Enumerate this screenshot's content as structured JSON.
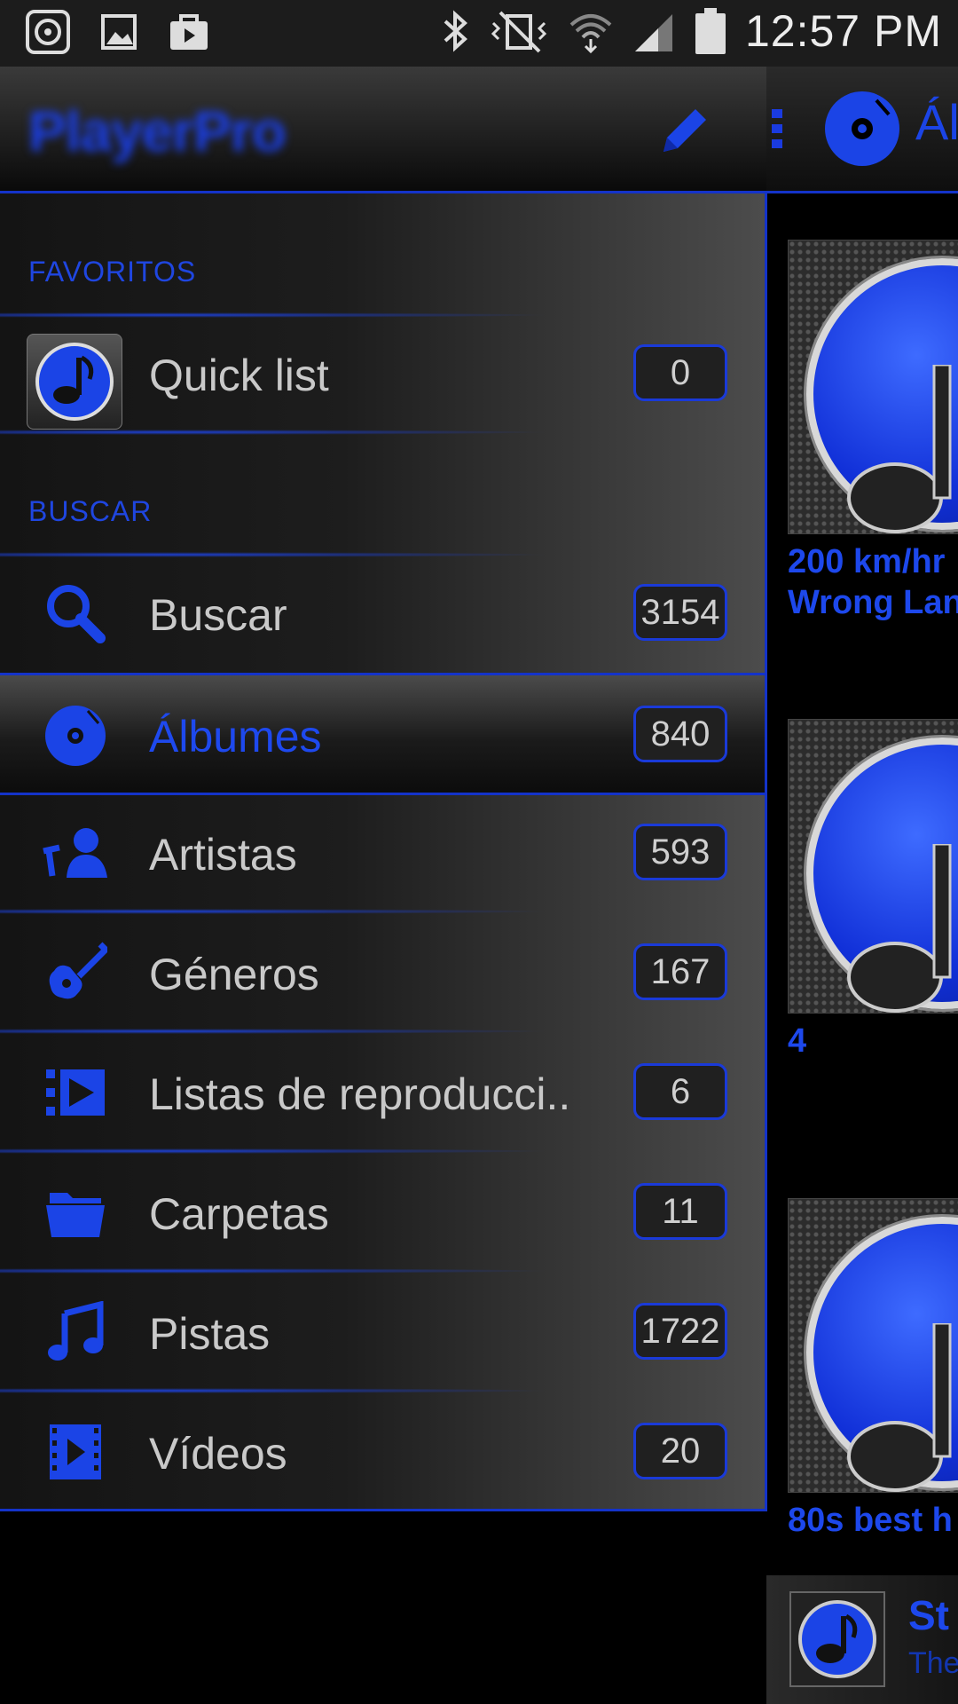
{
  "status_bar": {
    "time": "12:57 PM",
    "left_icons": [
      "media-icon",
      "gallery-icon",
      "store-bag-icon"
    ],
    "right_icons": [
      "bluetooth-icon",
      "vibrate-mute-icon",
      "wifi-icon",
      "signal-icon",
      "battery-icon"
    ]
  },
  "drawer": {
    "app_title": "PlayerPro",
    "edit_icon": "pencil-icon",
    "sections": {
      "favorites": "FAVORITOS",
      "search": "BUSCAR"
    },
    "items": [
      {
        "label": "Quick list",
        "count": "0",
        "icon": "music-note-app-icon"
      },
      {
        "label": "Buscar",
        "count": "3154",
        "icon": "search-icon"
      },
      {
        "label": "Álbumes",
        "count": "840",
        "icon": "album-disc-icon",
        "active": true
      },
      {
        "label": "Artistas",
        "count": "593",
        "icon": "artist-icon"
      },
      {
        "label": "Géneros",
        "count": "167",
        "icon": "guitar-icon"
      },
      {
        "label": "Listas de reproducci..",
        "count": "6",
        "icon": "playlist-icon"
      },
      {
        "label": "Carpetas",
        "count": "11",
        "icon": "folder-icon"
      },
      {
        "label": "Pistas",
        "count": "1722",
        "icon": "music-notes-icon"
      },
      {
        "label": "Vídeos",
        "count": "20",
        "icon": "video-icon"
      }
    ]
  },
  "main": {
    "title": "Ál",
    "albums": [
      {
        "name_line1": "200 km/hr",
        "name_line2": "Wrong Lan"
      },
      {
        "name_line1": "4",
        "name_line2": ""
      },
      {
        "name_line1": "80s best h",
        "name_line2": ""
      }
    ],
    "mini_player": {
      "title": "St",
      "subtitle": "The"
    }
  },
  "colors": {
    "accent": "#1b44e6",
    "background": "#000000",
    "text": "#c9c9c9"
  }
}
